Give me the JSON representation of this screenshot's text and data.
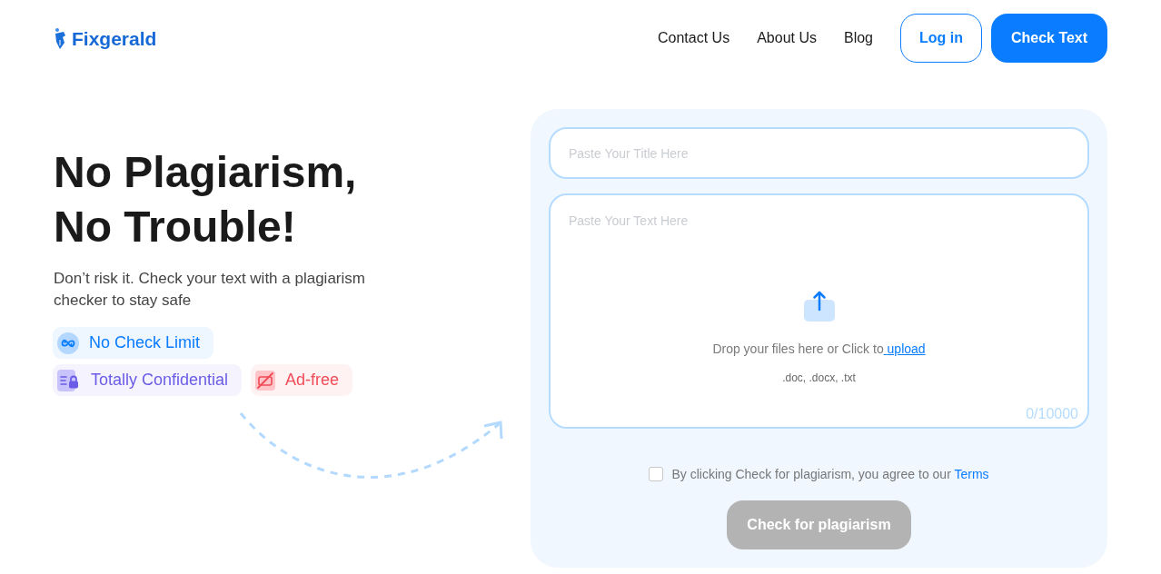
{
  "header": {
    "logo": "Fixgerald",
    "nav": [
      "Contact Us",
      "About Us",
      "Blog"
    ],
    "login_button": "Log in",
    "cta_button": "Check Text"
  },
  "hero": {
    "title_lines": [
      "No Plagiarism,",
      "No Trouble!"
    ],
    "subtitle": "Don’t risk it. Check your text with a plagiarism checker to stay safe",
    "feature_rows": [
      {
        "items": [
          {
            "kind": "limit",
            "label": "No Check Limit",
            "color": "#0a7cff"
          }
        ]
      },
      {
        "items": [
          {
            "kind": "confidential",
            "label": "Totally Confidential",
            "color": "#6b5ce7"
          },
          {
            "kind": "adfree",
            "label": "Ad-free",
            "color": "#f04b57"
          }
        ]
      }
    ]
  },
  "form": {
    "title_field": {
      "placeholder": "Paste Your Title Here"
    },
    "text_field": {
      "placeholder": "Paste Your Text Here"
    },
    "upload": {
      "prompt": "Drop your files here or Click to",
      "link": "upload",
      "formats": ".doc, .docx, .txt"
    },
    "counter": "0/10000",
    "agree": {
      "checked": false,
      "text": "By clicking Check for plagiarism, you agree to our",
      "link": "Terms"
    },
    "submit": {
      "label": "Check for plagiarism",
      "disabled": true
    }
  }
}
